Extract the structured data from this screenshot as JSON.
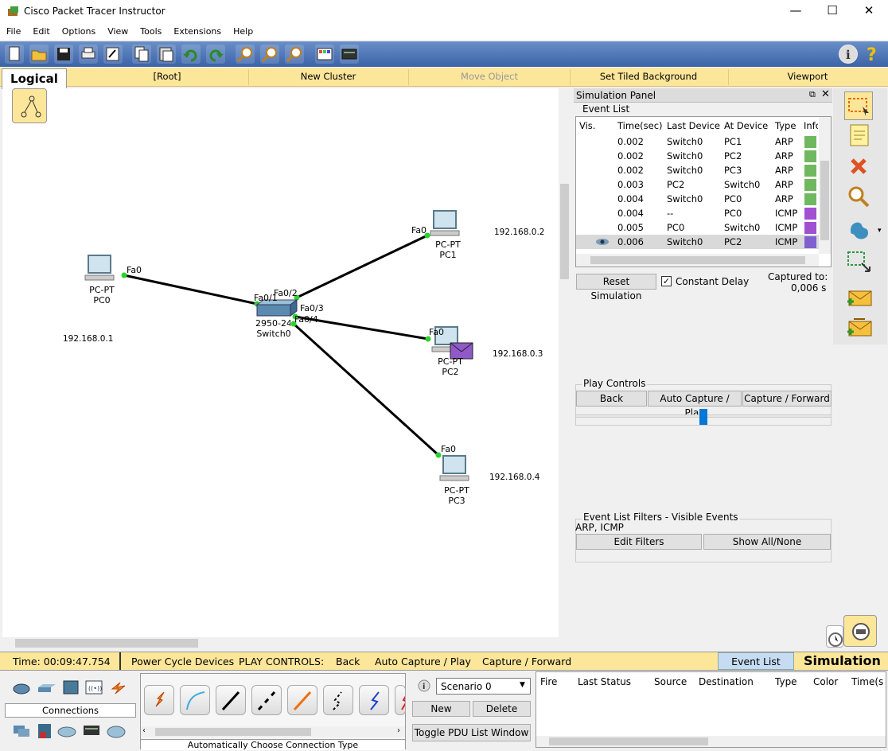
{
  "window": {
    "title": "Cisco Packet Tracer Instructor",
    "minimize": "—",
    "maximize": "☐",
    "close": "✕"
  },
  "menu": [
    "File",
    "Edit",
    "Options",
    "View",
    "Tools",
    "Extensions",
    "Help"
  ],
  "workspace_bar": {
    "tab": "Logical",
    "root": "[Root]",
    "new_cluster": "New Cluster",
    "move_object": "Move Object",
    "set_tiled_background": "Set Tiled Background",
    "viewport": "Viewport"
  },
  "topology": {
    "pc0": {
      "model": "PC-PT",
      "name": "PC0",
      "port": "Fa0",
      "ip": "192.168.0.1"
    },
    "pc1": {
      "model": "PC-PT",
      "name": "PC1",
      "port": "Fa0",
      "ip": "192.168.0.2"
    },
    "pc2": {
      "model": "PC-PT",
      "name": "PC2",
      "port": "Fa0",
      "ip": "192.168.0.3"
    },
    "pc3": {
      "model": "PC-PT",
      "name": "PC3",
      "port": "Fa0",
      "ip": "192.168.0.4"
    },
    "switch0": {
      "model": "2950-24",
      "name": "Switch0",
      "ports": [
        "Fa0/1",
        "Fa0/2",
        "Fa0/3",
        "Fa0/4"
      ]
    }
  },
  "sim_panel": {
    "title": "Simulation Panel",
    "event_list_label": "Event List",
    "columns": [
      "Vis.",
      "Time(sec)",
      "Last Device",
      "At Device",
      "Type",
      "Info"
    ],
    "events": [
      {
        "time": "0.002",
        "last": "Switch0",
        "at": "PC1",
        "type": "ARP",
        "color": "#70b860"
      },
      {
        "time": "0.002",
        "last": "Switch0",
        "at": "PC2",
        "type": "ARP",
        "color": "#70b860"
      },
      {
        "time": "0.002",
        "last": "Switch0",
        "at": "PC3",
        "type": "ARP",
        "color": "#70b860"
      },
      {
        "time": "0.003",
        "last": "PC2",
        "at": "Switch0",
        "type": "ARP",
        "color": "#70b860"
      },
      {
        "time": "0.004",
        "last": "Switch0",
        "at": "PC0",
        "type": "ARP",
        "color": "#70b860"
      },
      {
        "time": "0.004",
        "last": "--",
        "at": "PC0",
        "type": "ICMP",
        "color": "#a050d0"
      },
      {
        "time": "0.005",
        "last": "PC0",
        "at": "Switch0",
        "type": "ICMP",
        "color": "#a050d0"
      },
      {
        "time": "0.006",
        "last": "Switch0",
        "at": "PC2",
        "type": "ICMP",
        "color": "#8060d0"
      }
    ],
    "reset_simulation": "Reset Simulation",
    "constant_delay": "Constant Delay",
    "captured_to_label": "Captured to:",
    "captured_to_value": "0,006 s",
    "play_controls_label": "Play Controls",
    "back": "Back",
    "auto_capture_play": "Auto Capture / Play",
    "capture_forward": "Capture / Forward",
    "filters_label": "Event List Filters - Visible Events",
    "filters_value": "ARP, ICMP",
    "edit_filters": "Edit Filters",
    "show_all_none": "Show All/None"
  },
  "status": {
    "time": "Time: 00:09:47.754",
    "power_cycle": "Power Cycle Devices",
    "play_controls": "PLAY CONTROLS:",
    "back": "Back",
    "auto_capture_play": "Auto Capture / Play",
    "capture_forward": "Capture / Forward",
    "event_list": "Event List",
    "simulation": "Simulation"
  },
  "bottom": {
    "connections": "Connections",
    "conn_type": "Automatically Choose Connection Type",
    "scenario": "Scenario 0",
    "new": "New",
    "delete": "Delete",
    "toggle_pdu": "Toggle PDU List Window",
    "pdu_columns": [
      "Fire",
      "Last Status",
      "Source",
      "Destination",
      "Type",
      "Color",
      "Time(s"
    ]
  }
}
